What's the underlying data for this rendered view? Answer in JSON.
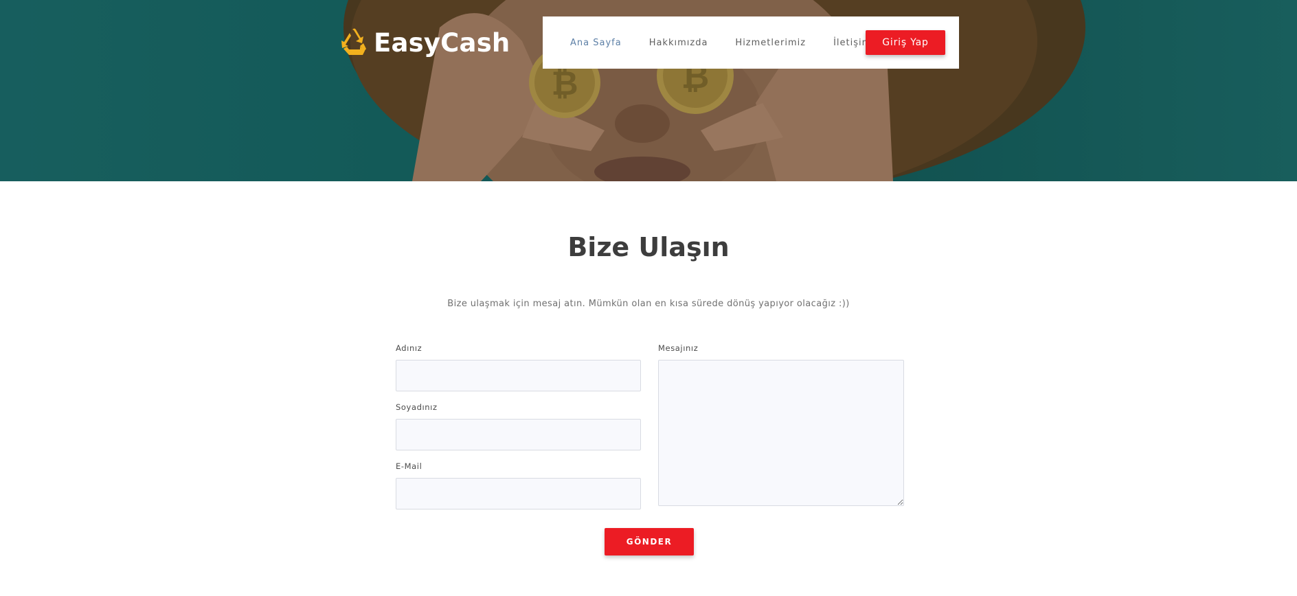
{
  "brand": {
    "name": "EasyCash",
    "icon": "recycle-icon",
    "icon_color": "#f2b01e"
  },
  "nav": {
    "items": [
      {
        "label": "Ana Sayfa",
        "active": true
      },
      {
        "label": "Hakkımızda",
        "active": false
      },
      {
        "label": "Hizmetlerimiz",
        "active": false
      },
      {
        "label": "İletişim",
        "active": false
      }
    ],
    "login_label": "Giriş Yap"
  },
  "contact": {
    "title": "Bize Ulaşın",
    "subtitle": "Bize ulaşmak için mesaj atın. Mümkün olan en kısa sürede dönüş yapıyor olacağız :))",
    "fields": {
      "first_name_label": "Adınız",
      "first_name_value": "",
      "last_name_label": "Soyadınız",
      "last_name_value": "",
      "email_label": "E-Mail",
      "email_value": "",
      "message_label": "Mesajınız",
      "message_value": ""
    },
    "submit_label": "GÖNDER"
  },
  "colors": {
    "accent_red": "#ec1c24",
    "hero_teal": "#176866",
    "active_nav": "#5c7fa6"
  }
}
